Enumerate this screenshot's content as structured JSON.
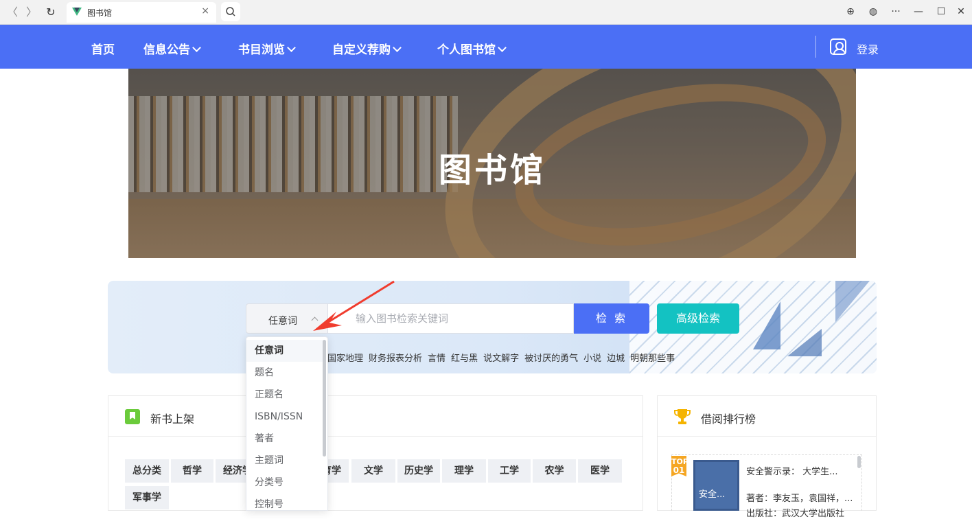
{
  "browser": {
    "tab_title": "图书馆",
    "close_glyph": "×",
    "back_glyph": "〈",
    "forward_glyph": "〉",
    "reload_glyph": "↻",
    "search_glyph": "⌕",
    "download_glyph": "⊕",
    "globe_glyph": "◍",
    "more_glyph": "···",
    "minimize_glyph": "—",
    "maximize_glyph": "☐",
    "window_close_glyph": "✕"
  },
  "nav": {
    "items": [
      {
        "label": "首页",
        "has_dropdown": false
      },
      {
        "label": "信息公告",
        "has_dropdown": true
      },
      {
        "label": "书目浏览",
        "has_dropdown": true
      },
      {
        "label": "自定义荐购",
        "has_dropdown": true
      },
      {
        "label": "个人图书馆",
        "has_dropdown": true
      }
    ],
    "login_label": "登录",
    "bg_color": "#4b6ff5"
  },
  "banner": {
    "title": "图书馆"
  },
  "search": {
    "field_selected": "任意词",
    "placeholder": "输入图书检索关键词",
    "search_button": "检 索",
    "advanced_button": "高级检索",
    "hot_words": [
      "国家地理",
      "财务报表分析",
      "言情",
      "红与黑",
      "说文解字",
      "被讨厌的勇气",
      "小说",
      "边城",
      "明朝那些事"
    ],
    "dropdown_options": [
      "任意词",
      "题名",
      "正题名",
      "ISBN/ISSN",
      "著者",
      "主题词",
      "分类号",
      "控制号"
    ]
  },
  "new_books": {
    "title": "新书上架",
    "categories": [
      "总分类",
      "哲学",
      "经济学",
      "",
      "教育学",
      "文学",
      "历史学",
      "理学",
      "工学",
      "农学",
      "医学",
      "军事学"
    ],
    "categories_visible": [
      "总分类",
      "哲学",
      "经济学",
      "",
      "育学",
      "文学",
      "历史学",
      "理学",
      "工学",
      "农学",
      "医学",
      "军事学"
    ]
  },
  "ranking": {
    "title": "借阅排行榜",
    "badge": "TOP\n01",
    "badge_top": "TOP",
    "badge_num": "01",
    "cover_text": "安全...",
    "book_title": "安全警示录： 大学生...",
    "book_author": "著者：李友玉，袁国祥，...",
    "book_publisher": "出版社：武汉大学出版社"
  },
  "colors": {
    "accent": "#4b6ff5",
    "advanced": "#13c2c2",
    "arrow": "#f03c2e"
  }
}
